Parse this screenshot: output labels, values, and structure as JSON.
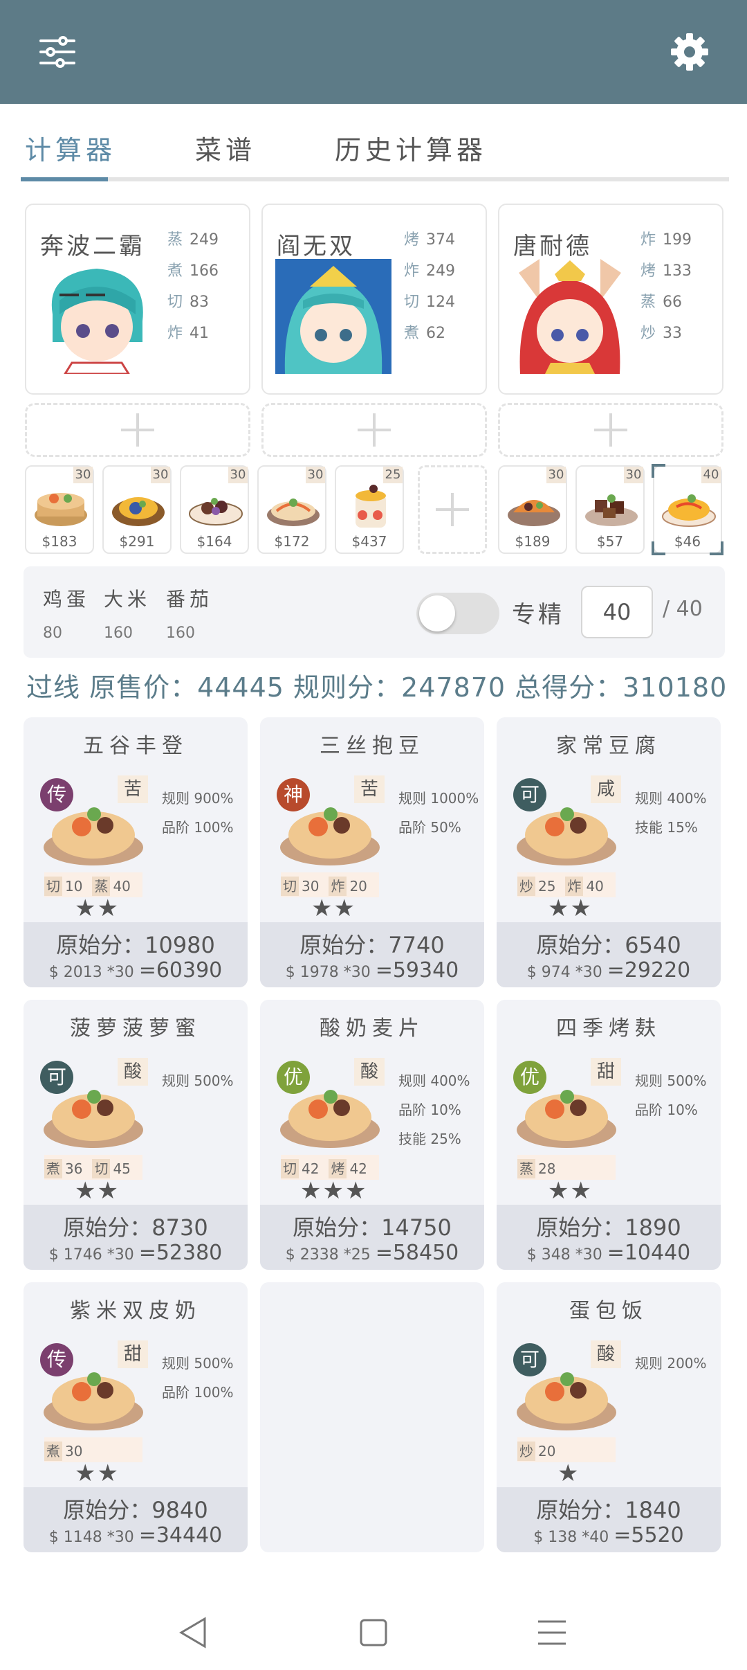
{
  "colors": {
    "appbar": "#5d7b87",
    "accent": "#5d8aa6",
    "grade_chuan": "#7b3f6e",
    "grade_shen": "#b84a2c",
    "grade_ke": "#3f5d60",
    "grade_you": "#7fa23b"
  },
  "appbar": {
    "menu_icon": "sliders-icon",
    "settings_icon": "gear-icon"
  },
  "tabs": [
    {
      "label": "计算器",
      "active": true
    },
    {
      "label": "菜谱",
      "active": false
    },
    {
      "label": "历史计算器",
      "active": false
    }
  ],
  "chefs": [
    {
      "name": "奔波二霸",
      "skills": [
        {
          "k": "蒸",
          "v": "249"
        },
        {
          "k": "煮",
          "v": "166"
        },
        {
          "k": "切",
          "v": "83"
        },
        {
          "k": "炸",
          "v": "41"
        }
      ]
    },
    {
      "name": "阎无双",
      "skills": [
        {
          "k": "烤",
          "v": "374"
        },
        {
          "k": "炸",
          "v": "249"
        },
        {
          "k": "切",
          "v": "124"
        },
        {
          "k": "煮",
          "v": "62"
        }
      ]
    },
    {
      "name": "唐耐德",
      "skills": [
        {
          "k": "炸",
          "v": "199"
        },
        {
          "k": "烤",
          "v": "133"
        },
        {
          "k": "蒸",
          "v": "66"
        },
        {
          "k": "炒",
          "v": "33"
        }
      ]
    }
  ],
  "recipe_slots": [
    {
      "qty": "30",
      "price": "$183"
    },
    {
      "qty": "30",
      "price": "$291"
    },
    {
      "qty": "30",
      "price": "$164"
    },
    {
      "qty": "30",
      "price": "$172"
    },
    {
      "qty": "25",
      "price": "$437"
    },
    {
      "qty": "30",
      "price": "$189"
    },
    {
      "qty": "30",
      "price": "$57"
    },
    {
      "qty": "40",
      "price": "$46"
    }
  ],
  "ingredients": [
    {
      "name": "鸡蛋",
      "value": "80"
    },
    {
      "name": "大米",
      "value": "160"
    },
    {
      "name": "番茄",
      "value": "160"
    }
  ],
  "specialize": {
    "label": "专精",
    "value": "40",
    "max": "/ 40",
    "enabled": false
  },
  "summary": "过线 原售价：44445 规则分：247870 总得分：310180",
  "dishes": [
    {
      "title": "五谷丰登",
      "grade": "传",
      "flavor": "苦",
      "rules": [
        "规则 900%",
        "品阶 100%"
      ],
      "skills": [
        {
          "t": "切",
          "v": "10"
        },
        {
          "t": "蒸",
          "v": "40"
        }
      ],
      "stars": "★★",
      "raw": "原始分：10980",
      "calc": "$ 2013 *30 ",
      "result": "=60390"
    },
    {
      "title": "三丝抱豆",
      "grade": "神",
      "flavor": "苦",
      "rules": [
        "规则 1000%",
        "品阶 50%"
      ],
      "skills": [
        {
          "t": "切",
          "v": "30"
        },
        {
          "t": "炸",
          "v": "20"
        }
      ],
      "stars": "★★",
      "raw": "原始分：7740",
      "calc": "$ 1978 *30 ",
      "result": "=59340"
    },
    {
      "title": "家常豆腐",
      "grade": "可",
      "flavor": "咸",
      "rules": [
        "规则 400%",
        "技能 15%"
      ],
      "skills": [
        {
          "t": "炒",
          "v": "25"
        },
        {
          "t": "炸",
          "v": "40"
        }
      ],
      "stars": "★★",
      "raw": "原始分：6540",
      "calc": "$ 974 *30 ",
      "result": "=29220"
    },
    {
      "title": "菠萝菠萝蜜",
      "grade": "可",
      "flavor": "酸",
      "rules": [
        "规则 500%"
      ],
      "skills": [
        {
          "t": "煮",
          "v": "36"
        },
        {
          "t": "切",
          "v": "45"
        }
      ],
      "stars": "★★",
      "raw": "原始分：8730",
      "calc": "$ 1746 *30 ",
      "result": "=52380"
    },
    {
      "title": "酸奶麦片",
      "grade": "优",
      "flavor": "酸",
      "rules": [
        "规则 400%",
        "品阶 10%",
        "技能 25%"
      ],
      "skills": [
        {
          "t": "切",
          "v": "42"
        },
        {
          "t": "烤",
          "v": "42"
        }
      ],
      "stars": "★★★",
      "raw": "原始分：14750",
      "calc": "$ 2338 *25 ",
      "result": "=58450"
    },
    {
      "title": "四季烤麸",
      "grade": "优",
      "flavor": "甜",
      "rules": [
        "规则 500%",
        "品阶 10%"
      ],
      "skills": [
        {
          "t": "蒸",
          "v": "28"
        }
      ],
      "stars": "★★",
      "raw": "原始分：1890",
      "calc": "$ 348 *30 ",
      "result": "=10440"
    },
    {
      "title": "紫米双皮奶",
      "grade": "传",
      "flavor": "甜",
      "rules": [
        "规则 500%",
        "品阶 100%"
      ],
      "skills": [
        {
          "t": "煮",
          "v": "30"
        }
      ],
      "stars": "★★",
      "raw": "原始分：9840",
      "calc": "$ 1148 *30 ",
      "result": "=34440"
    },
    {
      "title": "蛋包饭",
      "grade": "可",
      "flavor": "酸",
      "rules": [
        "规则 200%"
      ],
      "skills": [
        {
          "t": "炒",
          "v": "20"
        }
      ],
      "stars": "★",
      "raw": "原始分：1840",
      "calc": "$ 138 *40 ",
      "result": "=5520"
    }
  ],
  "navbar": {
    "back": "back-icon",
    "home": "home-icon",
    "menu": "menu-icon"
  }
}
